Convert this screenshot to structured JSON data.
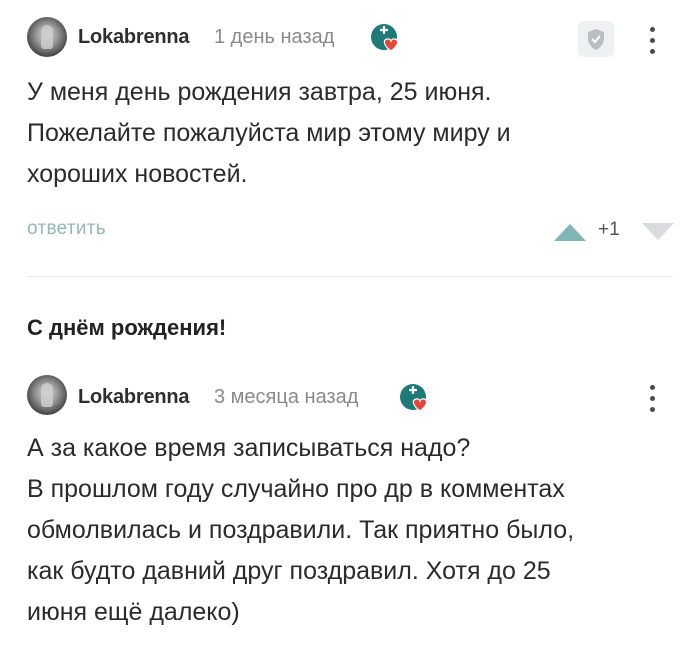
{
  "comments": [
    {
      "username": "Lokabrenna",
      "time": "1 день назад",
      "lines": [
        "У меня день рождения завтра, 25 июня.",
        "Пожелайте пожалуйста мир этому миру и",
        "хороших новостей."
      ],
      "reply_label": "ответить",
      "score": "+1"
    },
    {
      "username": "Lokabrenna",
      "time": "3 месяца назад",
      "lines": [
        "А за какое время записываться надо?",
        "В прошлом году случайно про др в комментах",
        "обмолвилась и поздравили. Так приятно было,",
        "как будто давний друг поздравил. Хотя до 25",
        "июня ещё далеко)"
      ]
    }
  ],
  "section_title": "С днём рождения!",
  "icons": {
    "avatar": "avatar-image",
    "badge": "heart-badge-icon",
    "shield": "shield-icon",
    "menu": "more-vertical-icon",
    "upvote": "triangle-up-icon",
    "downvote": "triangle-down-icon"
  },
  "colors": {
    "accent": "#7fb6b3",
    "heart": "#e6453a",
    "badge_bg": "#1e7a78",
    "reply": "#93b7b9",
    "muted": "#8a8a8a"
  }
}
